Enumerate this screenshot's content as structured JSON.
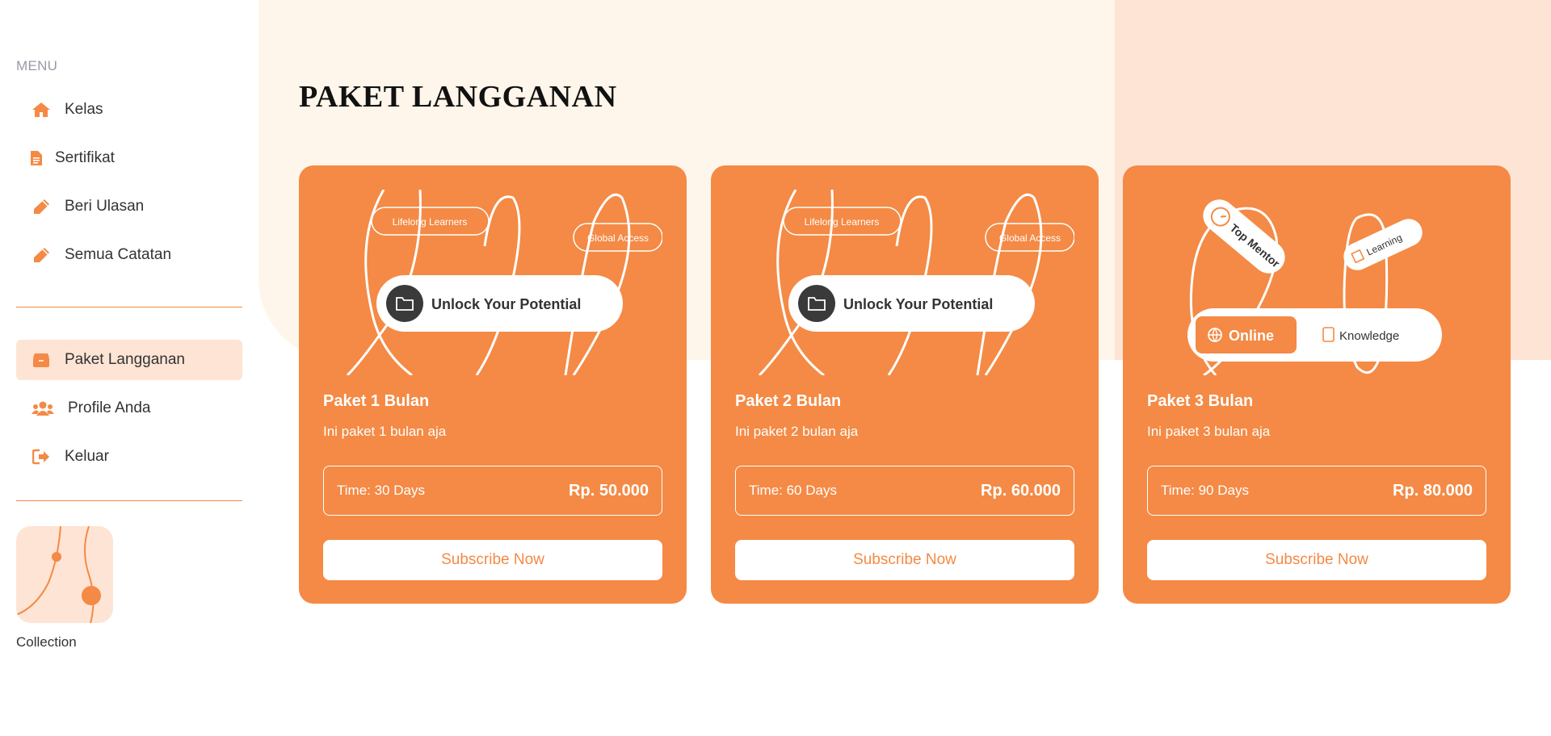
{
  "sidebar": {
    "menu_heading": "MENU",
    "items": [
      {
        "label": "Kelas",
        "icon": "home-icon"
      },
      {
        "label": "Sertifikat",
        "icon": "document-icon"
      },
      {
        "label": "Beri Ulasan",
        "icon": "pencil-icon"
      },
      {
        "label": "Semua Catatan",
        "icon": "pencil-icon"
      },
      {
        "label": "Paket Langganan",
        "icon": "box-icon",
        "active": true
      },
      {
        "label": "Profile Anda",
        "icon": "users-icon"
      },
      {
        "label": "Keluar",
        "icon": "logout-icon"
      }
    ],
    "collection_label": "Collection"
  },
  "main": {
    "title": "PAKET LANGGANAN",
    "cards": [
      {
        "name": "Paket 1 Bulan",
        "description": "Ini paket 1 bulan aja",
        "time": "Time: 30 Days",
        "price": "Rp. 50.000",
        "button": "Subscribe Now",
        "art": {
          "tag1": "Lifelong Learners",
          "tag2": "Global Access",
          "pill": "Unlock Your Potential"
        }
      },
      {
        "name": "Paket 2 Bulan",
        "description": "Ini paket 2 bulan aja",
        "time": "Time: 60 Days",
        "price": "Rp. 60.000",
        "button": "Subscribe Now",
        "art": {
          "tag1": "Lifelong Learners",
          "tag2": "Global Access",
          "pill": "Unlock Your Potential"
        }
      },
      {
        "name": "Paket 3 Bulan",
        "description": "Ini paket 3 bulan aja",
        "time": "Time: 90 Days",
        "price": "Rp. 80.000",
        "button": "Subscribe Now",
        "art": {
          "tag1": "Top Mentor",
          "tag2": "Learning",
          "pill_left": "Online",
          "pill_right": "Knowledge"
        }
      }
    ]
  },
  "colors": {
    "accent": "#f48a45",
    "active_bg": "#fde4d4",
    "cream_bg": "#fef6ea"
  }
}
